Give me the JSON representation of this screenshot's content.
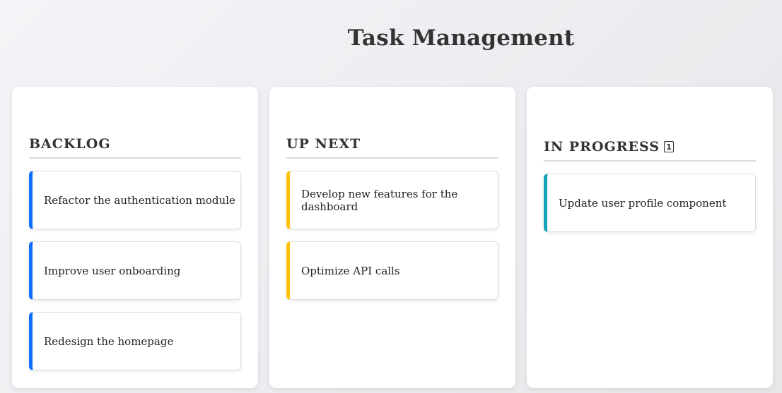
{
  "page": {
    "title": "Task Management"
  },
  "columns": [
    {
      "title": "BACKLOG",
      "accent": "#0d6efd",
      "tasks": [
        "Refactor the authentication module",
        "Improve user onboarding",
        "Redesign the homepage"
      ]
    },
    {
      "title": "UP NEXT",
      "accent": "#ffc107",
      "tasks": [
        "Develop new features for the dashboard",
        "Optimize API calls"
      ]
    },
    {
      "title": "IN PROGRESS",
      "accent": "#17a2b8",
      "count": "1",
      "count_icon": "numbered-box-icon",
      "tasks": [
        "Update user profile component"
      ]
    }
  ]
}
